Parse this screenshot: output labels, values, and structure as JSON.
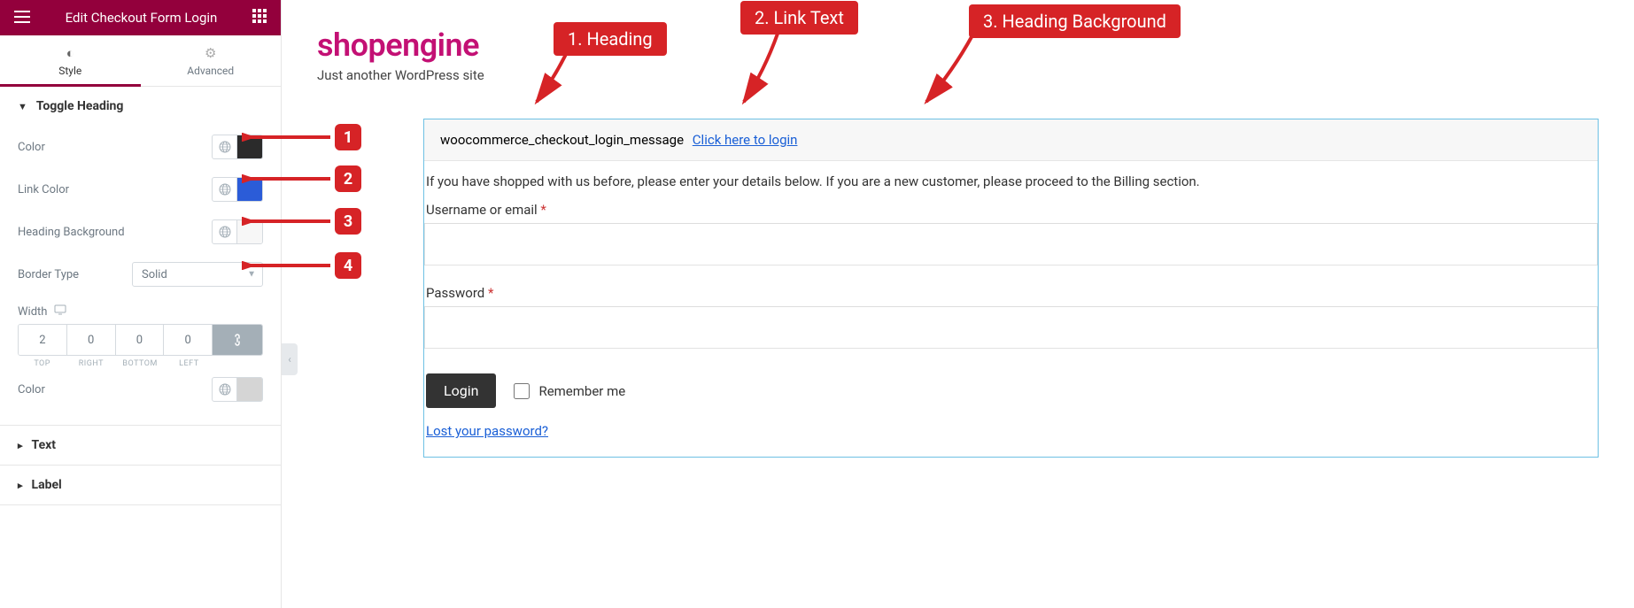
{
  "sidebar": {
    "title": "Edit Checkout Form Login",
    "tabs": {
      "style": "Style",
      "advanced": "Advanced"
    },
    "sections": {
      "toggle_heading": {
        "title": "Toggle Heading",
        "color_label": "Color",
        "link_color_label": "Link Color",
        "heading_bg_label": "Heading Background",
        "border_type_label": "Border Type",
        "border_type_value": "Solid",
        "width_label": "Width",
        "width_top": "2",
        "width_right": "0",
        "width_bottom": "0",
        "width_left": "0",
        "dim_top": "TOP",
        "dim_right": "RIGHT",
        "dim_bottom": "BOTTOM",
        "dim_left": "LEFT",
        "color2_label": "Color"
      },
      "text": {
        "title": "Text"
      },
      "label": {
        "title": "Label"
      }
    }
  },
  "main": {
    "brand": "shopengine",
    "tagline": "Just another WordPress site",
    "notice_msg": "woocommerce_checkout_login_message",
    "notice_link": "Click here to login",
    "intro": "If you have shopped with us before, please enter your details below. If you are a new customer, please proceed to the Billing section.",
    "username_label": "Username or email ",
    "password_label": "Password ",
    "required": "*",
    "login_btn": "Login",
    "remember": "Remember me",
    "lost_pw": "Lost your password?"
  },
  "callouts": {
    "c1": "1. Heading",
    "c2": "2. Link Text",
    "c3": "3. Heading Background",
    "n1": "1",
    "n2": "2",
    "n3": "3",
    "n4": "4"
  }
}
